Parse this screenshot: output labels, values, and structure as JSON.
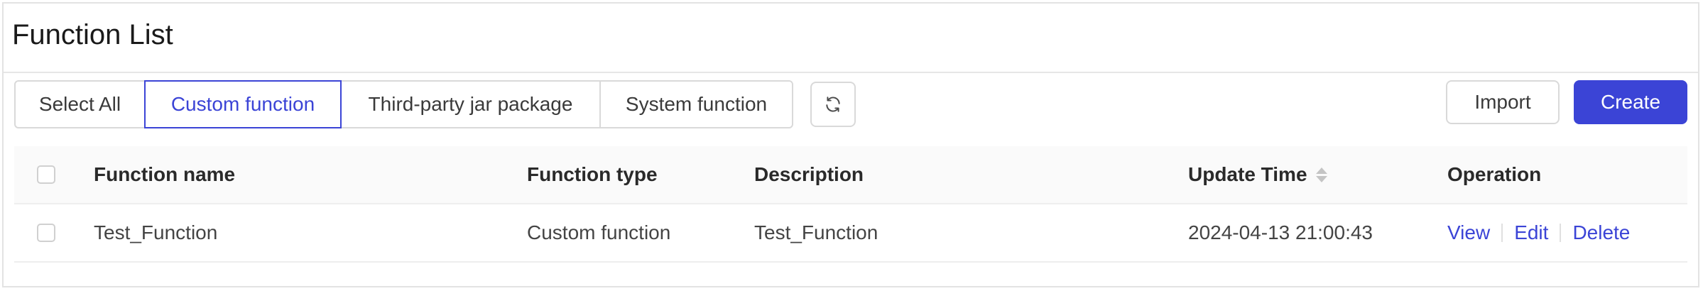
{
  "page": {
    "title": "Function List"
  },
  "filters": {
    "tabs": [
      {
        "label": "Select All",
        "active": false
      },
      {
        "label": "Custom function",
        "active": true
      },
      {
        "label": "Third-party jar package",
        "active": false
      },
      {
        "label": "System function",
        "active": false
      }
    ],
    "refresh_icon": "refresh-icon"
  },
  "actions": {
    "import_label": "Import",
    "create_label": "Create"
  },
  "table": {
    "columns": [
      "Function name",
      "Function type",
      "Description",
      "Update Time",
      "Operation"
    ],
    "rows": [
      {
        "name": "Test_Function",
        "type": "Custom function",
        "description": "Test_Function",
        "update_time": "2024-04-13 21:00:43",
        "operations": [
          "View",
          "Edit",
          "Delete"
        ]
      }
    ]
  },
  "colors": {
    "accent": "#3b44d6",
    "border": "#d9d9d9",
    "header_bg": "#fafafa"
  }
}
